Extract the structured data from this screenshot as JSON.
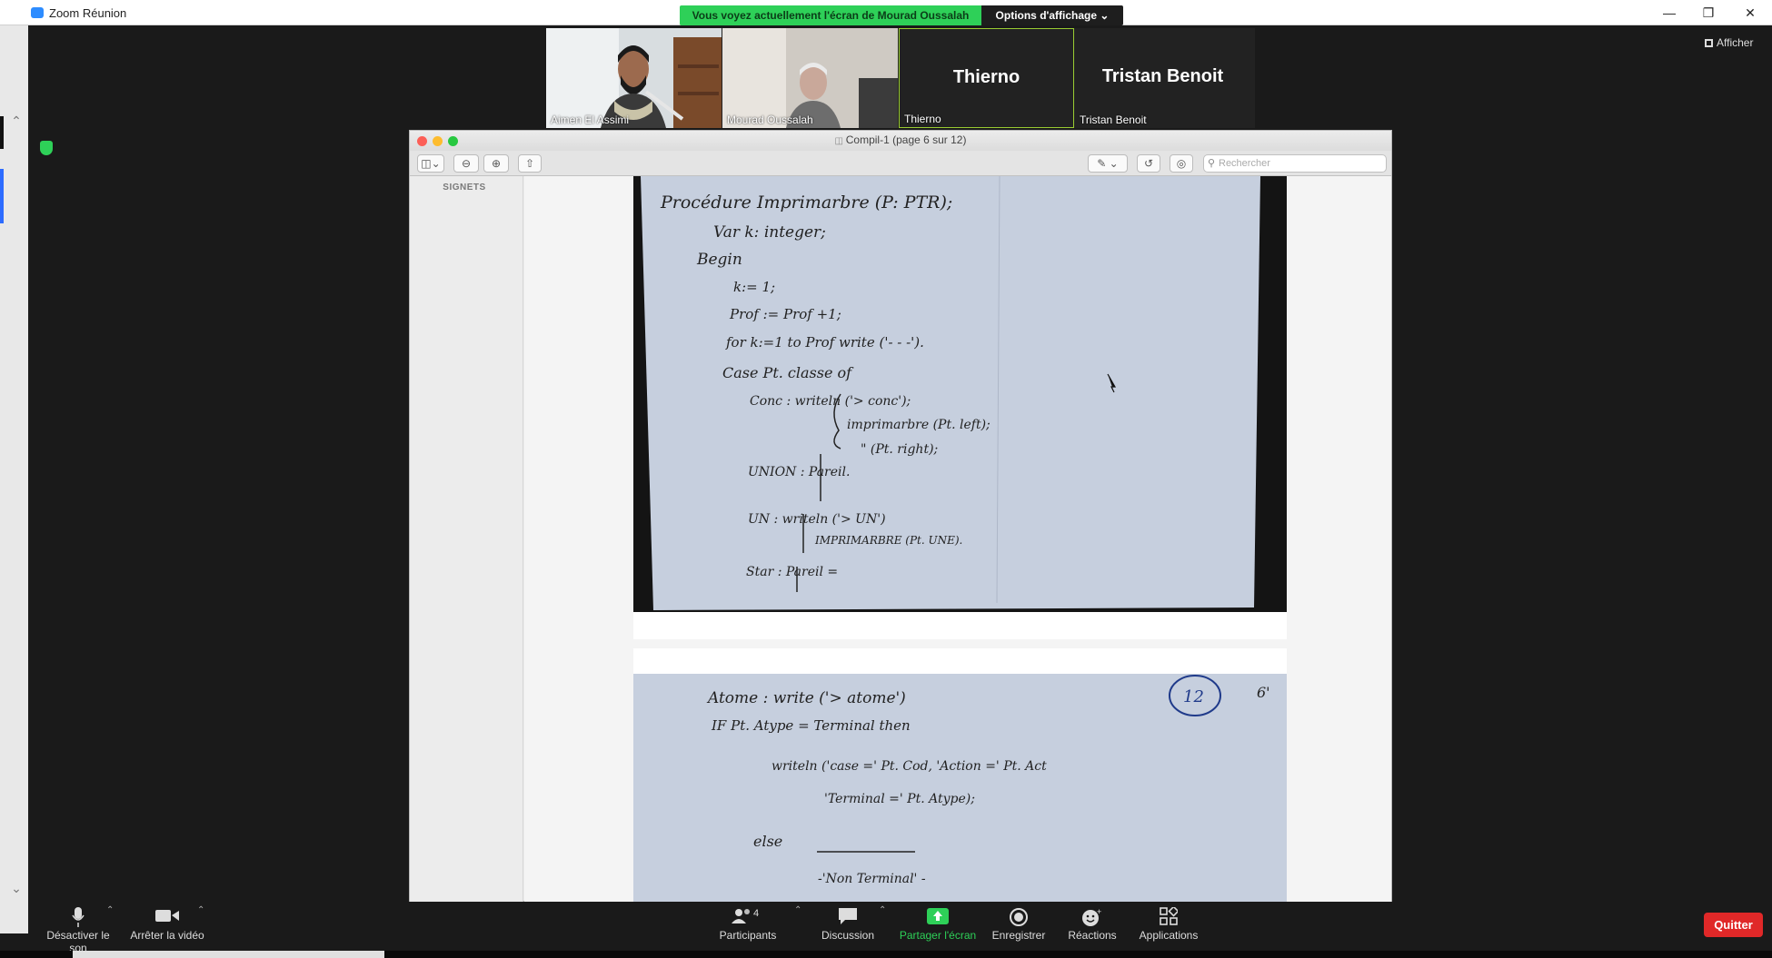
{
  "window": {
    "title": "Zoom Réunion"
  },
  "share_banner": {
    "text": "Vous voyez actuellement l'écran de Mourad Oussalah",
    "view_options": "Options d'affichage"
  },
  "participants_gallery": [
    {
      "name": "Aimen El Assimi",
      "has_video": true
    },
    {
      "name": "Mourad Oussalah",
      "has_video": true
    },
    {
      "name": "Thierno",
      "big_label": "Thierno",
      "has_video": false,
      "active_speaker": true
    },
    {
      "name": "Tristan Benoit",
      "big_label": "Tristan Benoit",
      "has_video": false
    }
  ],
  "afficher_label": "Afficher",
  "preview": {
    "title": "Compil-1 (page 6 sur 12)",
    "search_placeholder": "Rechercher",
    "sidebar_label": "SIGNETS",
    "page1_lines": [
      "Procédure Imprimarbre (P: PTR);",
      "Var k: integer;",
      "Begin",
      "k:= 1;",
      "Prof := Prof +1;",
      "for k:=1 to Prof write ('- - -').",
      "Case Pt. classe of",
      "Conc : writeln ('> conc');",
      "imprimarbre (Pt. left);",
      "\"     (Pt. right);",
      "UNION : Pareil.",
      "UN : writeln ('> UN')",
      "IMPRIMARBRE (Pt. UNE).",
      "Star : Pareil ="
    ],
    "page2_lines": [
      "Atome : write ('> atome')",
      "IF Pt. Atype = Terminal then",
      "writeln ('case =' Pt. Cod, 'Action =' Pt. Act",
      "'Terminal =' Pt. Atype);",
      "else",
      "-'Non Terminal' -"
    ],
    "page2_corner_number": "12",
    "page2_corner_mark": "6'"
  },
  "controls": {
    "mute": "Désactiver le son",
    "video": "Arrêter la vidéo",
    "participants": "Participants",
    "participants_count": "4",
    "chat": "Discussion",
    "share": "Partager l'écran",
    "record": "Enregistrer",
    "reactions": "Réactions",
    "apps": "Applications",
    "quit": "Quitter"
  },
  "colors": {
    "zoom_blue": "#2D8CFF",
    "share_green": "#2ED058",
    "quit_red": "#E02828"
  }
}
